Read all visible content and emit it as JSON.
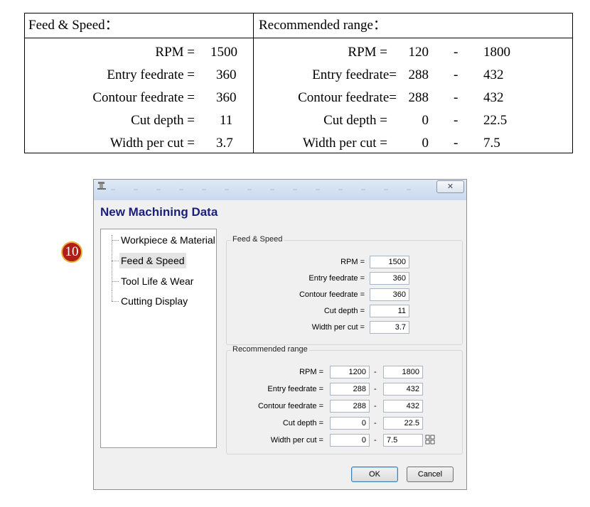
{
  "doc_table": {
    "left_header": "Feed & Speed：",
    "right_header": "Recommended range：",
    "rows": [
      {
        "label": "RPM =",
        "value": "1500",
        "r_label": "RPM =",
        "r_min": "120",
        "r_sep": "-",
        "r_max": "1800"
      },
      {
        "label": "Entry  feedrate =",
        "value": "360",
        "r_label": "Entry feedrate=",
        "r_min": "288",
        "r_sep": "-",
        "r_max": "432"
      },
      {
        "label": "Contour  feedrate =",
        "value": "360",
        "r_label": "Contour  feedrate=",
        "r_min": "288",
        "r_sep": "-",
        "r_max": "432"
      },
      {
        "label": "Cut depth =",
        "value": "11",
        "r_label": "Cut depth =",
        "r_min": "0",
        "r_sep": "-",
        "r_max": "22.5"
      },
      {
        "label": "Width per cut =",
        "value": "3.7",
        "r_label": "Width per cut =",
        "r_min": "0",
        "r_sep": "-",
        "r_max": "7.5"
      }
    ]
  },
  "badge": {
    "number": "10"
  },
  "dialog": {
    "close_glyph": "✕",
    "title": "New Machining Data",
    "tree": [
      {
        "label": "Workpiece & Material"
      },
      {
        "label": "Feed & Speed"
      },
      {
        "label": "Tool Life & Wear"
      },
      {
        "label": "Cutting Display"
      }
    ],
    "feed_speed": {
      "title": "Feed & Speed",
      "fields": [
        {
          "label": "RPM =",
          "value": "1500"
        },
        {
          "label": "Entry feedrate =",
          "value": "360"
        },
        {
          "label": "Contour feedrate =",
          "value": "360"
        },
        {
          "label": "Cut depth =",
          "value": "11"
        },
        {
          "label": "Width per cut =",
          "value": "3.7"
        }
      ]
    },
    "recommended": {
      "title": "Recommended range",
      "separator": "-",
      "fields": [
        {
          "label": "RPM =",
          "min": "1200",
          "max": "1800"
        },
        {
          "label": "Entry feedrate =",
          "min": "288",
          "max": "432"
        },
        {
          "label": "Contour feedrate =",
          "min": "288",
          "max": "432"
        },
        {
          "label": "Cut depth =",
          "min": "0",
          "max": "22.5"
        },
        {
          "label": "Width per cut =",
          "min": "0",
          "max": "7.5"
        }
      ]
    },
    "ok_label": "OK",
    "cancel_label": "Cancel",
    "spin_icon": "grid-spin-icon"
  }
}
